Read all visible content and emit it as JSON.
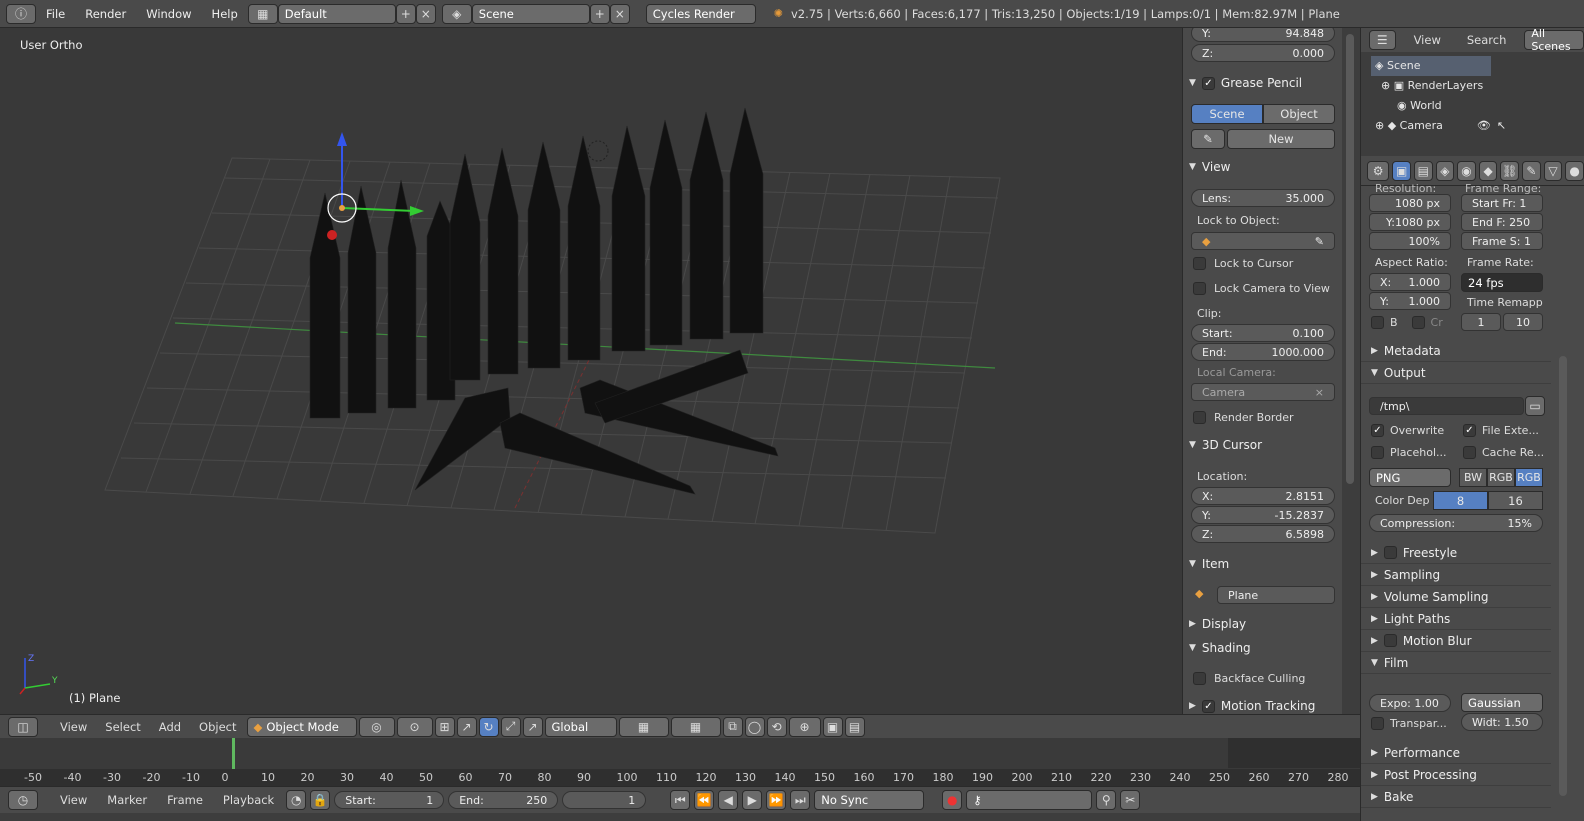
{
  "topbar": {
    "menus": [
      "File",
      "Render",
      "Window",
      "Help"
    ],
    "layout": "Default",
    "scene": "Scene",
    "engine": "Cycles Render",
    "stats": "v2.75 | Verts:6,660 | Faces:6,177 | Tris:13,250 | Objects:1/19 | Lamps:0/1 | Mem:82.97M | Plane"
  },
  "viewport": {
    "view_name": "User Ortho",
    "object_label": "(1) Plane",
    "axis_z": "Z",
    "axis_y": "Y"
  },
  "header3d": {
    "items": [
      "View",
      "Select",
      "Add",
      "Object"
    ],
    "mode": "Object Mode",
    "orientation": "Global"
  },
  "timeline": {
    "ticks": [
      "-50",
      "-40",
      "-30",
      "-20",
      "-10",
      "0",
      "10",
      "20",
      "30",
      "40",
      "50",
      "60",
      "70",
      "80",
      "90",
      "100",
      "110",
      "120",
      "130",
      "140",
      "150",
      "160",
      "170",
      "180",
      "190",
      "200",
      "210",
      "220",
      "230",
      "240",
      "250",
      "260",
      "270",
      "280"
    ],
    "current_frame": "0"
  },
  "tlbar": {
    "items": [
      "View",
      "Marker",
      "Frame",
      "Playback"
    ],
    "start_label": "Start:",
    "start_value": "1",
    "end_label": "End:",
    "end_value": "250",
    "frame": "1",
    "sync": "No Sync"
  },
  "npanel": {
    "y_label": "Y:",
    "y_value": "94.848",
    "z_label": "Z:",
    "z_value": "0.000",
    "grease_pencil": "Grease Pencil",
    "gp_scene": "Scene",
    "gp_object": "Object",
    "gp_new": "New",
    "view": "View",
    "lens_label": "Lens:",
    "lens_value": "35.000",
    "lock_obj": "Lock to Object:",
    "lock_cursor": "Lock to Cursor",
    "lock_camera": "Lock Camera to View",
    "clip": "Clip:",
    "clip_start_label": "Start:",
    "clip_start": "0.100",
    "clip_end_label": "End:",
    "clip_end": "1000.000",
    "local_camera": "Local Camera:",
    "camera": "Camera",
    "render_border": "Render Border",
    "cursor": "3D Cursor",
    "location": "Location:",
    "cx": "2.8151",
    "cy": "-15.2837",
    "cz": "6.5898",
    "x_label": "X:",
    "item": "Item",
    "item_name": "Plane",
    "display": "Display",
    "shading": "Shading",
    "backface": "Backface Culling",
    "motion": "Motion Tracking"
  },
  "outliner": {
    "view": "View",
    "search": "Search",
    "all_scenes": "All Scenes",
    "items": [
      "Scene",
      "RenderLayers",
      "World",
      "Camera"
    ]
  },
  "props": {
    "resolution": "Resolution:",
    "frame_range": "Frame Range:",
    "res_x": "1080 px",
    "res_y": "Y:1080 px",
    "res_pct": "100%",
    "start_fr": "Start Fr: 1",
    "end_f": "End F: 250",
    "frame_s": "Frame S: 1",
    "aspect": "Aspect Ratio:",
    "frame_rate": "Frame Rate:",
    "ax": "1.000",
    "ay": "1.000",
    "fps": "24 fps",
    "time_remap": "Time Remapp",
    "b": "B",
    "cr": "Cr",
    "remap_old": "1",
    "remap_new": "10",
    "metadata": "Metadata",
    "output": "Output",
    "path": "/tmp\\",
    "overwrite": "Overwrite",
    "file_ext": "File Exte...",
    "placeholders": "Placehol...",
    "cache": "Cache Re...",
    "format": "PNG",
    "bw": "BW",
    "rgb": "RGB",
    "rgba": "RGB",
    "color_depth": "Color Dep",
    "d8": "8",
    "d16": "16",
    "compression": "Compression:",
    "comp_val": "15%",
    "freestyle": "Freestyle",
    "sampling": "Sampling",
    "volume": "Volume Sampling",
    "light": "Light Paths",
    "motion_blur": "Motion Blur",
    "film": "Film",
    "expo": "Expo: 1.00",
    "filter": "Gaussian",
    "transparent": "Transpar...",
    "width": "Widt: 1.50",
    "performance": "Performance",
    "post": "Post Processing",
    "bake": "Bake"
  }
}
